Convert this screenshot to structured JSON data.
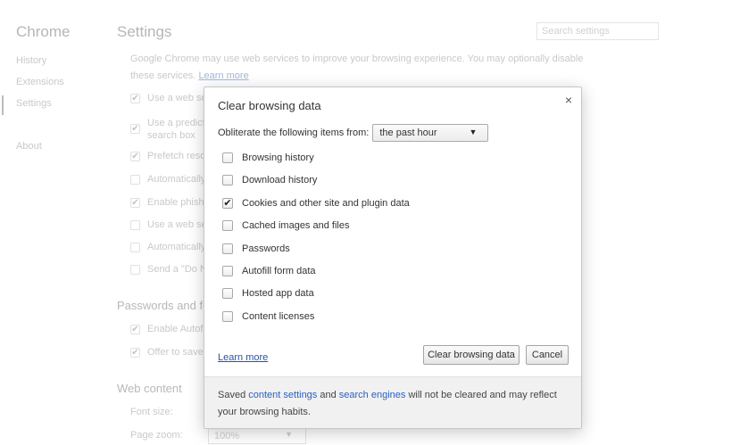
{
  "sidebar": {
    "brand": "Chrome",
    "items": [
      {
        "label": "History"
      },
      {
        "label": "Extensions"
      },
      {
        "label": "Settings"
      },
      {
        "label": "About"
      }
    ]
  },
  "settings": {
    "title": "Settings",
    "search_placeholder": "Search settings",
    "description": "Google Chrome may use web services to improve your browsing experience. You may optionally disable these services.",
    "description_link": "Learn more",
    "privacy_rows": [
      {
        "label": "Use a web ser",
        "checked": true
      },
      {
        "label": "Use a predicti",
        "label2": "search box",
        "checked": true
      },
      {
        "label": "Prefetch resou",
        "checked": true
      },
      {
        "label": "Automatically",
        "checked": false
      },
      {
        "label": "Enable phishin",
        "checked": true
      },
      {
        "label": "Use a web ser",
        "checked": false
      },
      {
        "label": "Automatically",
        "checked": false
      },
      {
        "label": "Send a \"Do No",
        "checked": false
      }
    ],
    "passwords_section": "Passwords and for",
    "passwords_rows": [
      {
        "label": "Enable Autofil",
        "checked": true
      },
      {
        "label": "Offer to save y",
        "checked": true
      }
    ],
    "web_content_section": "Web content",
    "font_size_label": "Font size:",
    "page_zoom_label": "Page zoom:",
    "page_zoom_value": "100%"
  },
  "dialog": {
    "title": "Clear browsing data",
    "close_glyph": "×",
    "obliterate_label": "Obliterate the following items from:",
    "period_value": "the past hour",
    "options": [
      {
        "label": "Browsing history",
        "checked": false
      },
      {
        "label": "Download history",
        "checked": false
      },
      {
        "label": "Cookies and other site and plugin data",
        "checked": true
      },
      {
        "label": "Cached images and files",
        "checked": false
      },
      {
        "label": "Passwords",
        "checked": false
      },
      {
        "label": "Autofill form data",
        "checked": false
      },
      {
        "label": "Hosted app data",
        "checked": false
      },
      {
        "label": "Content licenses",
        "checked": false
      }
    ],
    "learn_more": "Learn more",
    "clear_button": "Clear browsing data",
    "cancel_button": "Cancel",
    "footer": {
      "part1": "Saved ",
      "link1": "content settings",
      "part2": " and ",
      "link2": "search engines",
      "part3": " will not be cleared and may reflect your browsing habits."
    }
  },
  "icons": {
    "check": "✔",
    "dropdown_arrow": "▼"
  }
}
